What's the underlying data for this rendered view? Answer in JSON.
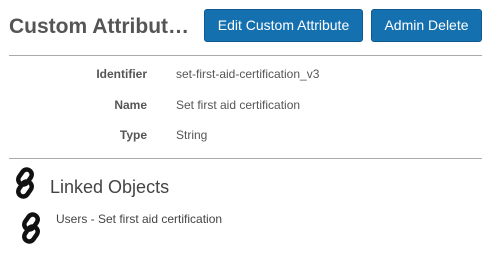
{
  "header": {
    "title": "Custom Attribute…",
    "edit_button_label": "Edit Custom Attribute",
    "delete_button_label": "Admin Delete"
  },
  "details": {
    "identifier_label": "Identifier",
    "identifier_value": "set-first-aid-certification_v3",
    "name_label": "Name",
    "name_value": "Set first aid certification",
    "type_label": "Type",
    "type_value": "String"
  },
  "linked_objects": {
    "title": "Linked Objects",
    "items": [
      {
        "label": "Users - Set first aid certification",
        "icon": "link-icon"
      }
    ]
  },
  "colors": {
    "button_bg": "#1570b0",
    "title_text": "#555555",
    "rule": "#aaaaaa"
  }
}
